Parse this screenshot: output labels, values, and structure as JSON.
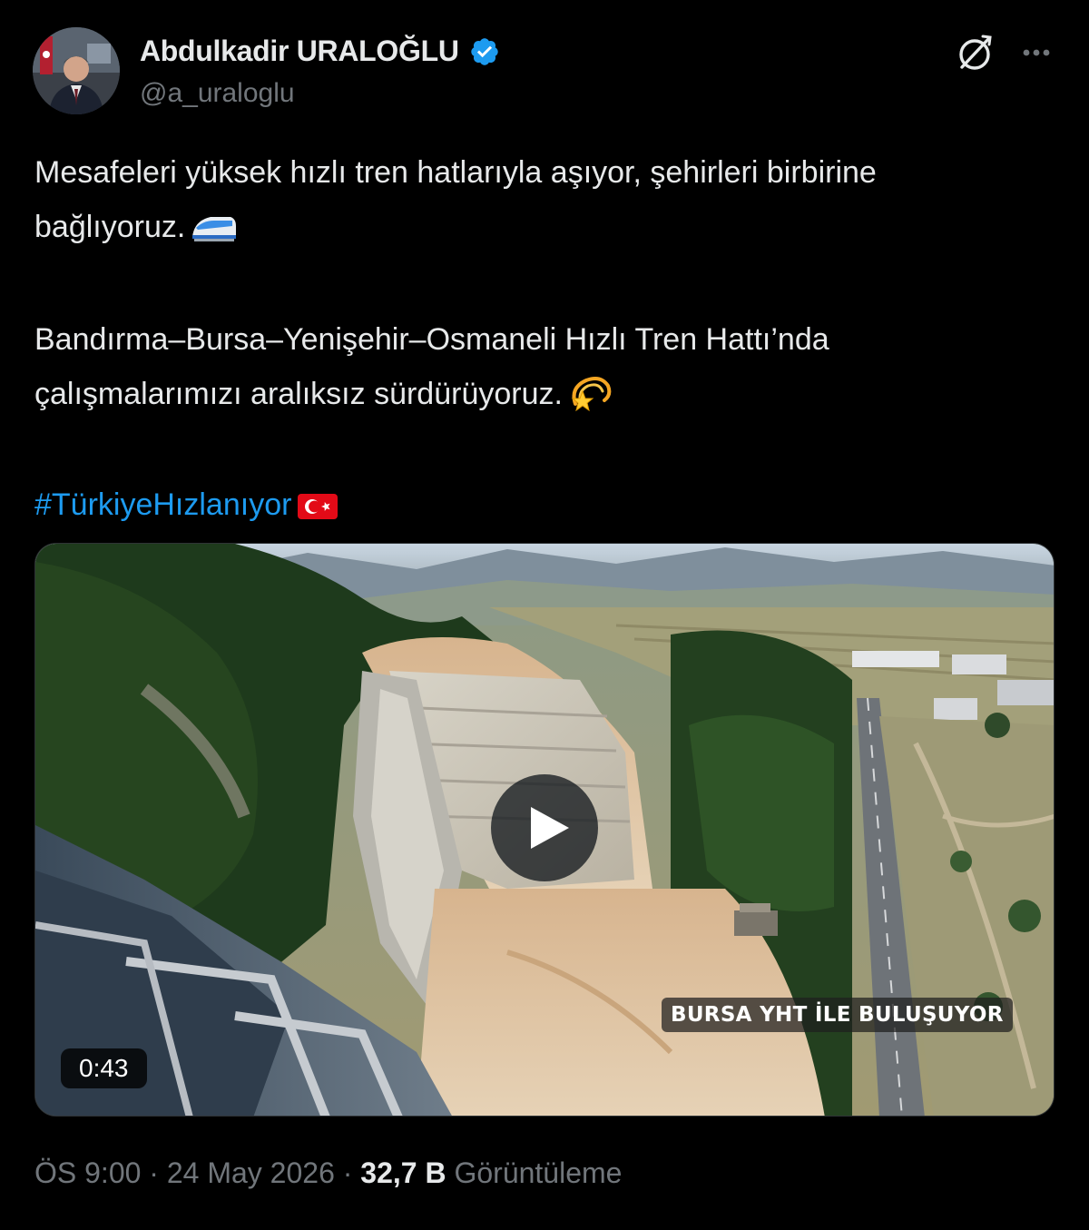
{
  "author": {
    "display_name": "Abdulkadir URALOĞLU",
    "handle": "@a_uraloglu",
    "verified_color": "#1d9bf0"
  },
  "tweet": {
    "line1": "Mesafeleri yüksek hızlı tren hatlarıyla aşıyor, şehirleri birbirine",
    "line2": "bağlıyoruz.",
    "line3": "Bandırma–Bursa–Yenişehir–Osmaneli Hızlı Tren Hattı’nda",
    "line4": "çalışmalarımızı aralıksız sürdürüyoruz.",
    "hashtag": "#TürkiyeHızlanıyor",
    "emoji_1": "high-speed-train-icon",
    "emoji_2": "dizzy-icon",
    "emoji_3": "turkey-flag-icon"
  },
  "media": {
    "caption": "BURSA YHT İLE BULUŞUYOR",
    "duration": "0:43"
  },
  "meta": {
    "time": "ÖS 9:00",
    "separator": "·",
    "date": "24 May 2026",
    "views_count": "32,7 B",
    "views_label": "Görüntüleme"
  },
  "colors": {
    "background": "#000000",
    "text": "#e7e9ea",
    "secondary": "#71767b",
    "link": "#1d9bf0"
  }
}
